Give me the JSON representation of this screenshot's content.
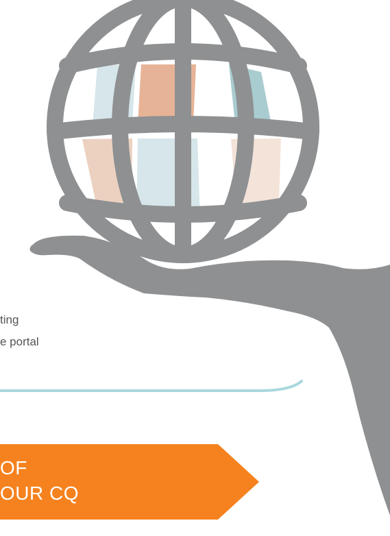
{
  "content": {
    "text_lines": [
      "ting",
      "e portal"
    ],
    "banner": {
      "line_1": "OF",
      "line_2": "OUR CQ",
      "color": "#f5821f"
    }
  },
  "colors": {
    "globe_gray": "#8e9092",
    "hand_gray": "#8e9092",
    "divider_blue": "#a9d8de",
    "tile_light_blue": "#d6e6ea",
    "tile_peach": "#e7b396",
    "tile_teal": "#a9ccd0",
    "tile_light_peach": "#ecd1c1",
    "tile_pale_peach": "#f4e3d9",
    "text_gray": "#555555"
  },
  "icons": {
    "globe": "globe-icon",
    "hand": "open-hand-icon"
  }
}
